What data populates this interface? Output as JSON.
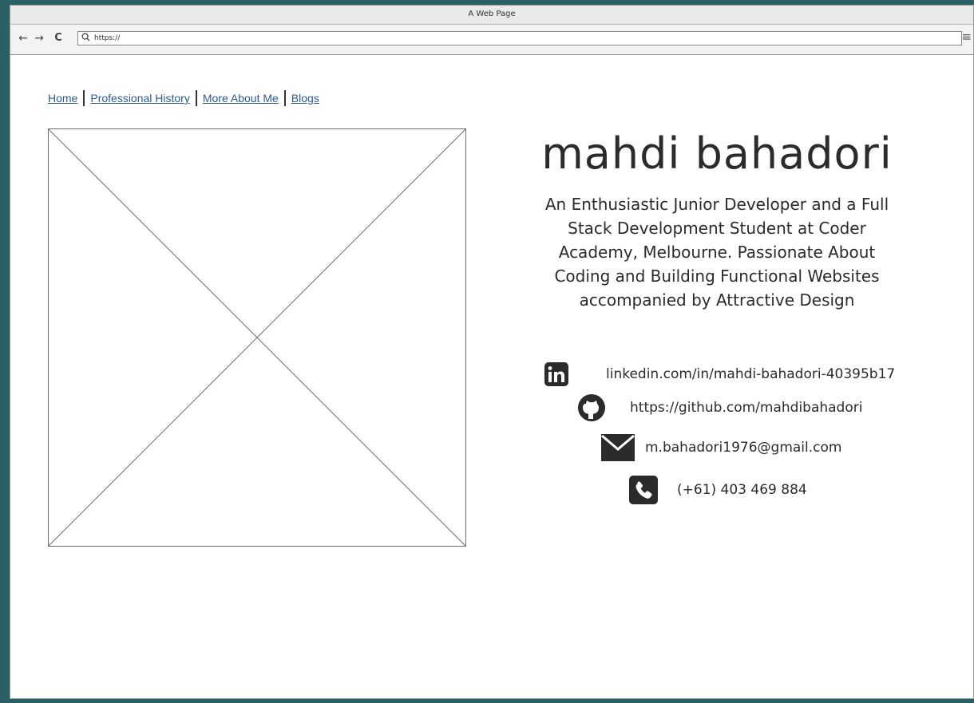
{
  "window": {
    "title": "A Web Page",
    "url": "https://"
  },
  "toolbar": {
    "back_icon": "←",
    "forward_icon": "→",
    "reload_icon": "C",
    "search_icon": "⚲",
    "menu_icon": "≡"
  },
  "nav": {
    "items": [
      {
        "label": "Home"
      },
      {
        "label": "Professional History"
      },
      {
        "label": "More About Me"
      },
      {
        "label": "Blogs"
      }
    ]
  },
  "profile": {
    "name": "mahdi bahadori",
    "bio": "An Enthusiastic Junior Developer and a Full Stack Development Student at Coder Academy, Melbourne. Passionate About Coding and Building Functional Websites accompanied by Attractive Design"
  },
  "contacts": {
    "linkedin": "linkedin.com/in/mahdi-bahadori-40395b17",
    "github": "https://github.com/mahdibahadori",
    "email": "m.bahadori1976@gmail.com",
    "phone": "(+61) 403 469 884"
  },
  "icons": {
    "linkedin": "linkedin-icon",
    "github": "github-icon",
    "email": "mail-icon",
    "phone": "phone-icon"
  },
  "colors": {
    "frame": "#2a5f63",
    "link": "#2c5b91",
    "text": "#2b2b2b"
  }
}
